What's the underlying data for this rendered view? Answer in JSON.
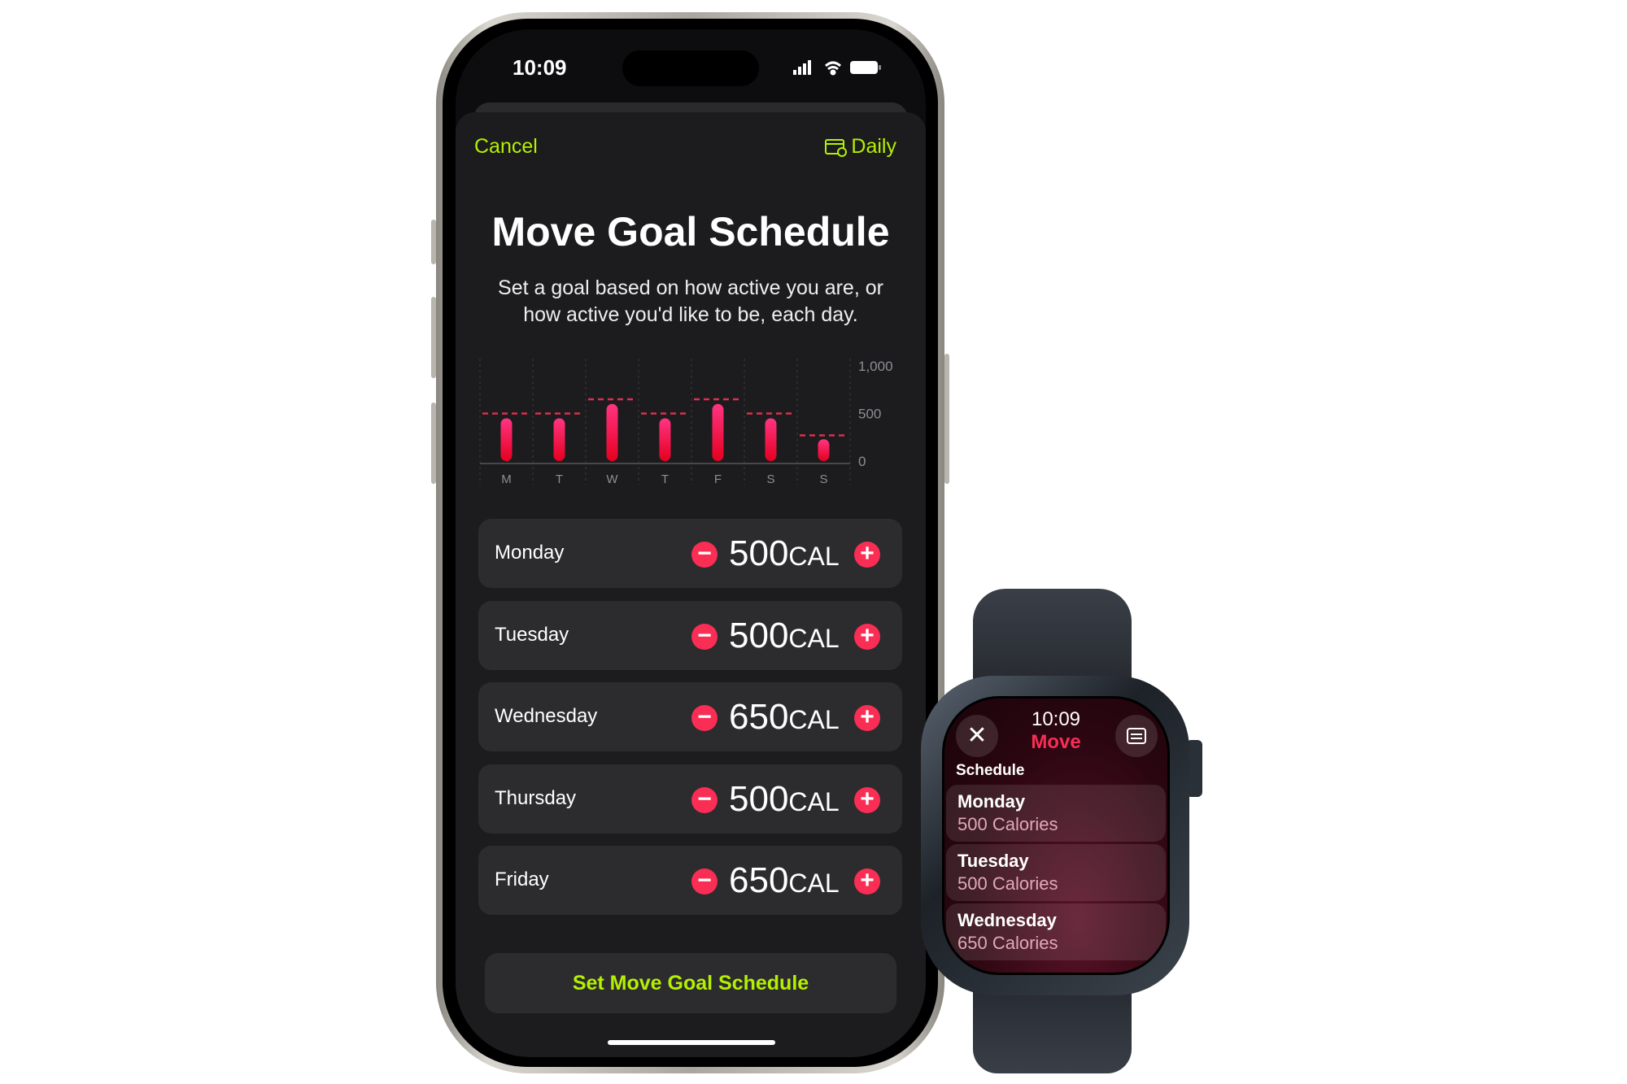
{
  "phone": {
    "status": {
      "time": "10:09",
      "signal_icon": "cellular-signal-icon",
      "wifi_icon": "wifi-icon",
      "battery_icon": "battery-icon"
    },
    "nav": {
      "cancel": "Cancel",
      "daily": "Daily",
      "daily_icon": "calendar-icon"
    },
    "title": "Move Goal Schedule",
    "subtitle": "Set a goal based on how active you are, or how active you'd like to be, each day.",
    "rows": [
      {
        "day": "Monday",
        "value": "500",
        "unit": "CAL"
      },
      {
        "day": "Tuesday",
        "value": "500",
        "unit": "CAL"
      },
      {
        "day": "Wednesday",
        "value": "650",
        "unit": "CAL"
      },
      {
        "day": "Thursday",
        "value": "500",
        "unit": "CAL"
      },
      {
        "day": "Friday",
        "value": "650",
        "unit": "CAL"
      }
    ],
    "set_button": "Set Move Goal Schedule",
    "accent": "#b4f000",
    "ring_color": "#fa2d55"
  },
  "chart_data": {
    "type": "bar",
    "categories": [
      "M",
      "T",
      "W",
      "T",
      "F",
      "S",
      "S"
    ],
    "series": [
      {
        "values": [
          450,
          450,
          600,
          450,
          600,
          450,
          230
        ]
      }
    ],
    "goals": [
      500,
      500,
      650,
      500,
      650,
      500,
      270
    ],
    "yticks": [
      "1,000",
      "500",
      "0"
    ],
    "ylim": [
      0,
      1000
    ],
    "grid": true
  },
  "watch": {
    "time": "10:09",
    "app": "Move",
    "section": "Schedule",
    "close_icon": "close-icon",
    "list_icon": "list-icon",
    "items": [
      {
        "day": "Monday",
        "calories": "500 Calories"
      },
      {
        "day": "Tuesday",
        "calories": "500 Calories"
      },
      {
        "day": "Wednesday",
        "calories": "650 Calories"
      }
    ]
  }
}
